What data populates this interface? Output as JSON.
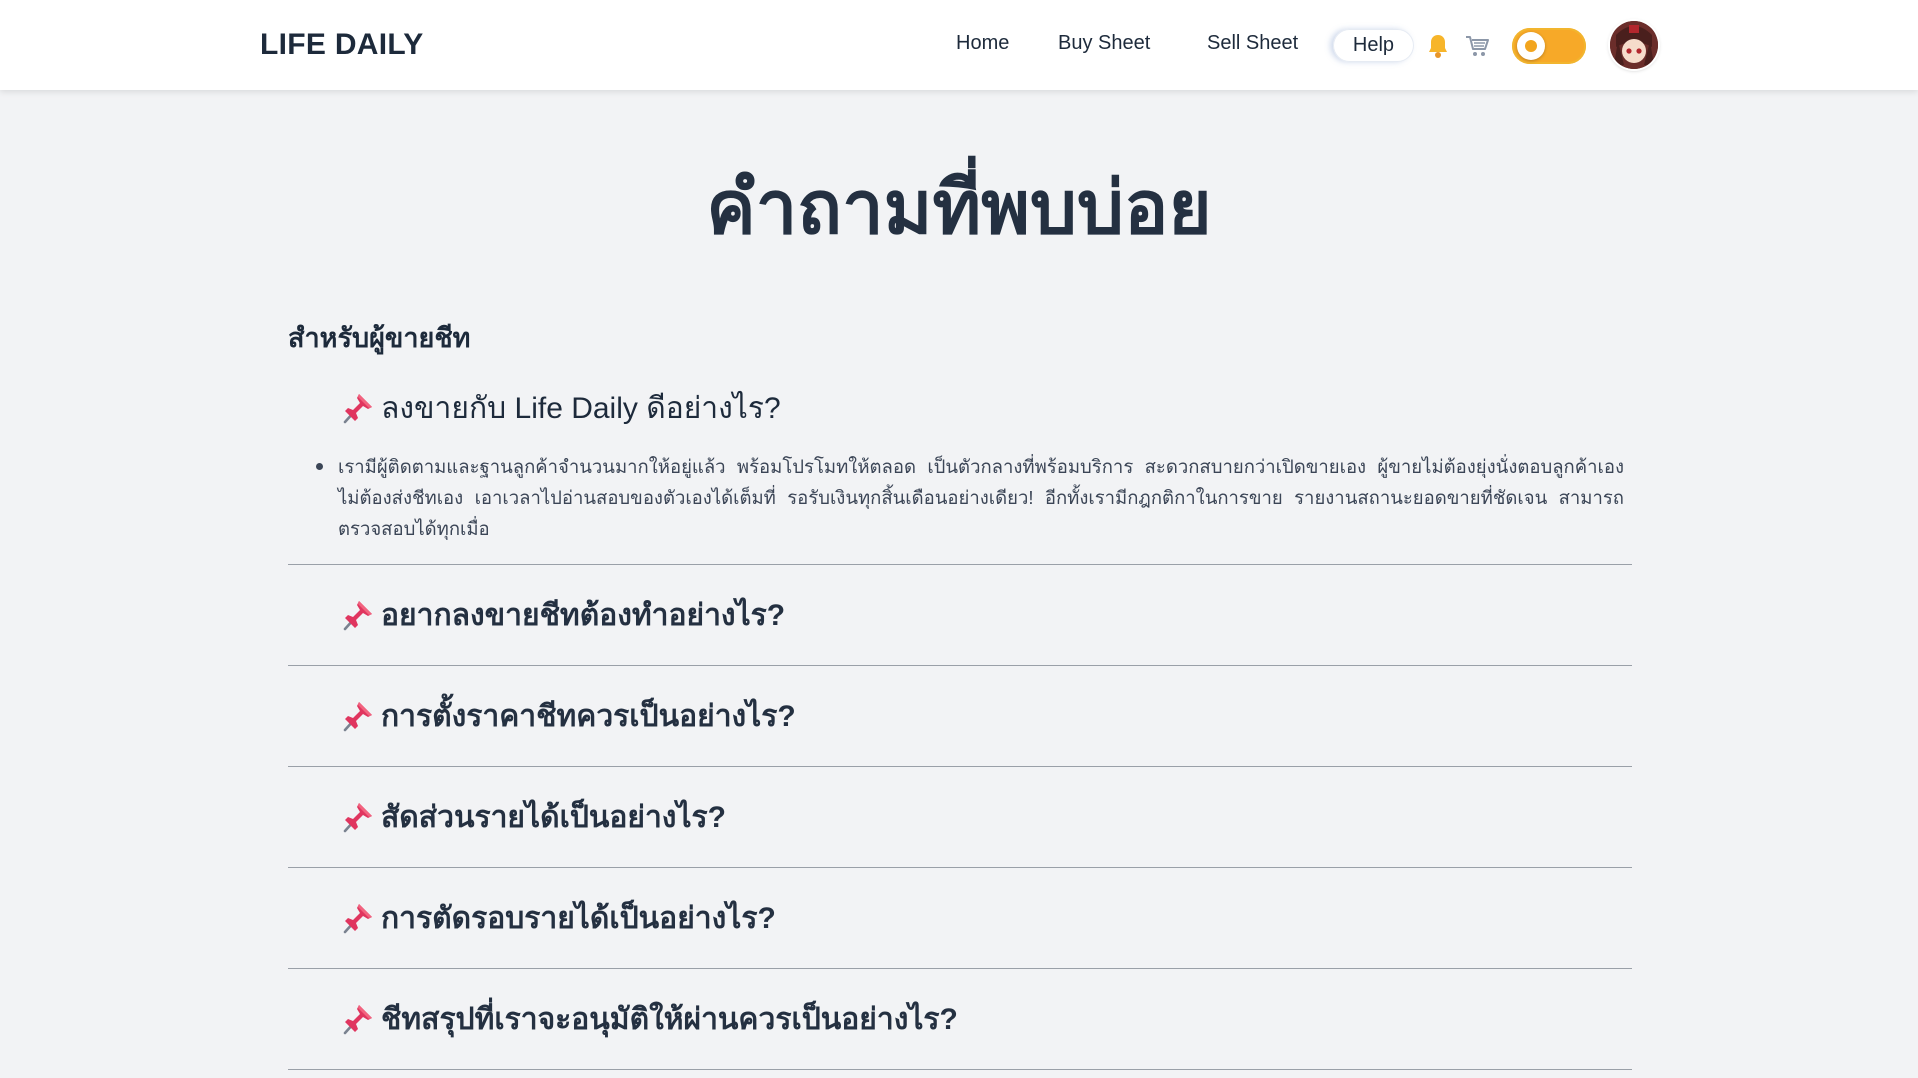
{
  "header": {
    "brand": "LIFE DAILY",
    "nav": {
      "home": "Home",
      "buy": "Buy Sheet",
      "sell": "Sell Sheet",
      "help": "Help"
    },
    "icons": [
      "bell-icon",
      "cart-icon",
      "theme-toggle",
      "avatar"
    ]
  },
  "page": {
    "title": "คำถามที่พบบ่อย",
    "section_heading": "สำหรับผู้ขายชีท"
  },
  "faq": [
    {
      "question": "ลงขายกับ Life Daily ดีอย่างไร?",
      "answer": "เรามีผู้ติดตามและฐานลูกค้าจำนวนมากให้อยู่แล้ว พร้อมโปรโมทให้ตลอด เป็นตัวกลางที่พร้อมบริการ สะดวกสบายกว่าเปิดขายเอง ผู้ขายไม่ต้องยุ่งนั่งตอบลูกค้าเอง ไม่ต้องส่งชีทเอง เอาเวลาไปอ่านสอบของตัวเองได้เต็มที่ รอรับเงินทุกสิ้นเดือนอย่างเดียว! อีกทั้งเรามีกฎกติกาในการขาย รายงานสถานะยอดขายที่ชัดเจน สามารถตรวจสอบได้ทุกเมื่อ"
    },
    {
      "question": "อยากลงขายชีทต้องทำอย่างไร?"
    },
    {
      "question": "การตั้งราคาชีทควรเป็นอย่างไร?"
    },
    {
      "question": "สัดส่วนรายได้เป็นอย่างไร?"
    },
    {
      "question": "การตัดรอบรายได้เป็นอย่างไร?"
    },
    {
      "question": "ชีทสรุปที่เราจะอนุมัติให้ผ่านควรเป็นอย่างไร?"
    }
  ],
  "colors": {
    "background": "#f2f3f5",
    "text": "#243041",
    "toggle": "#f7a928",
    "pin": "#e0355f"
  }
}
